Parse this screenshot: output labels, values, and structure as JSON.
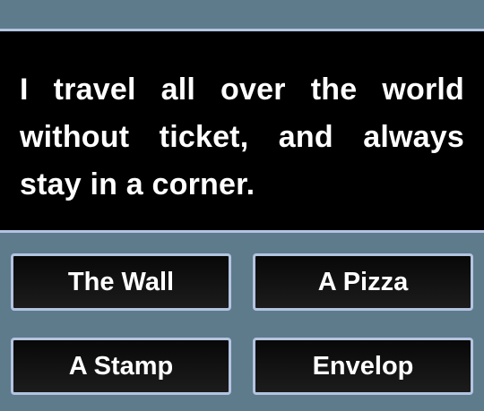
{
  "question": {
    "text": "I travel all over the world without ticket, and always stay in a corner."
  },
  "answers": [
    {
      "label": "The Wall"
    },
    {
      "label": "A Pizza"
    },
    {
      "label": "A Stamp"
    },
    {
      "label": "Envelop"
    }
  ],
  "colors": {
    "background": "#5e7b8c",
    "panel": "#000000",
    "border": "#b3c4e0",
    "text": "#ffffff"
  }
}
